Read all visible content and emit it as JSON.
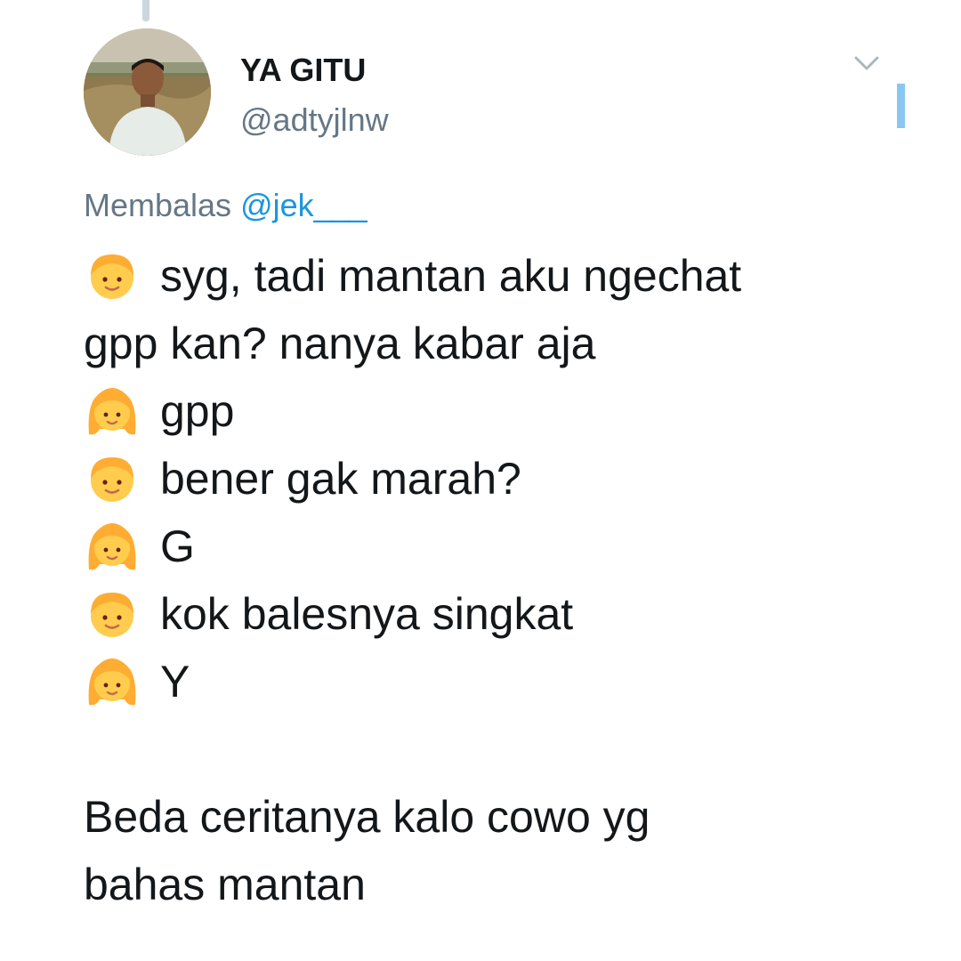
{
  "tweet": {
    "display_name": "YA GITU",
    "handle": "@adtyjlnw",
    "reply_prefix": "Membalas",
    "reply_to": "@jek___",
    "lines": [
      {
        "emoji": "boy-icon",
        "text": "syg, tadi mantan aku ngechat"
      },
      {
        "emoji": "",
        "text": "gpp kan? nanya kabar aja"
      },
      {
        "emoji": "girl-icon",
        "text": "gpp"
      },
      {
        "emoji": "boy-icon",
        "text": "bener gak marah?"
      },
      {
        "emoji": "girl-icon",
        "text": "G"
      },
      {
        "emoji": "boy-icon",
        "text": "kok balesnya singkat"
      },
      {
        "emoji": "girl-icon",
        "text": "Y"
      }
    ],
    "closing_lines": [
      "Beda ceritanya kalo cowo yg",
      "bahas mantan"
    ]
  },
  "colors": {
    "link": "#1b95e0",
    "secondary_text": "#657786",
    "emoji_face": "#ffcc4d",
    "emoji_hair": "#ffac33"
  }
}
